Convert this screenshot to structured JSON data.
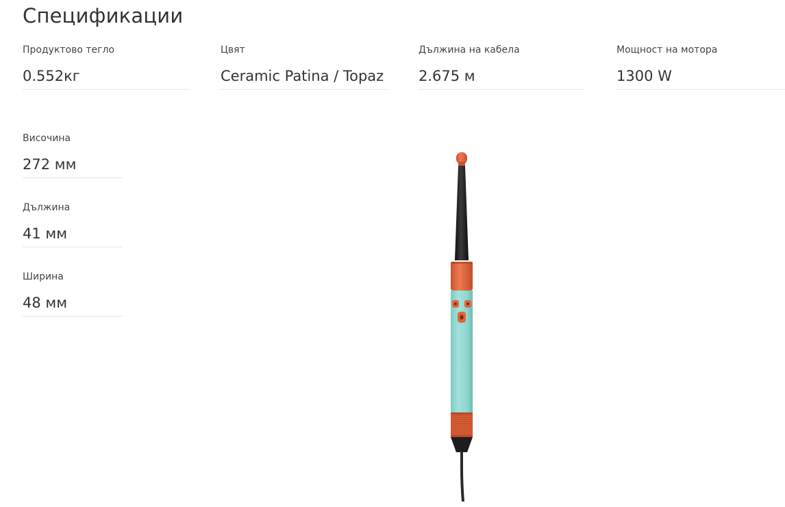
{
  "title": "Спецификации",
  "specs_top": [
    {
      "label": "Продуктово тегло",
      "value": "0.552кг"
    },
    {
      "label": "Цвят",
      "value": "Ceramic Patina / Topaz"
    },
    {
      "label": "Дължина на кабела",
      "value": "2.675 м"
    },
    {
      "label": "Мощност на мотора",
      "value": "1300 W"
    }
  ],
  "specs_dimensions": [
    {
      "label": "Височина",
      "value": "272 мм"
    },
    {
      "label": "Дължина",
      "value": "41 мм"
    },
    {
      "label": "Ширина",
      "value": "48 мм"
    }
  ],
  "product_image": {
    "icon": "hair-styler-product-image",
    "colors": {
      "body": "#8fd6cf",
      "accent": "#e0663f",
      "barrel": "#1f1f1f",
      "cable": "#2a2a2a"
    }
  }
}
